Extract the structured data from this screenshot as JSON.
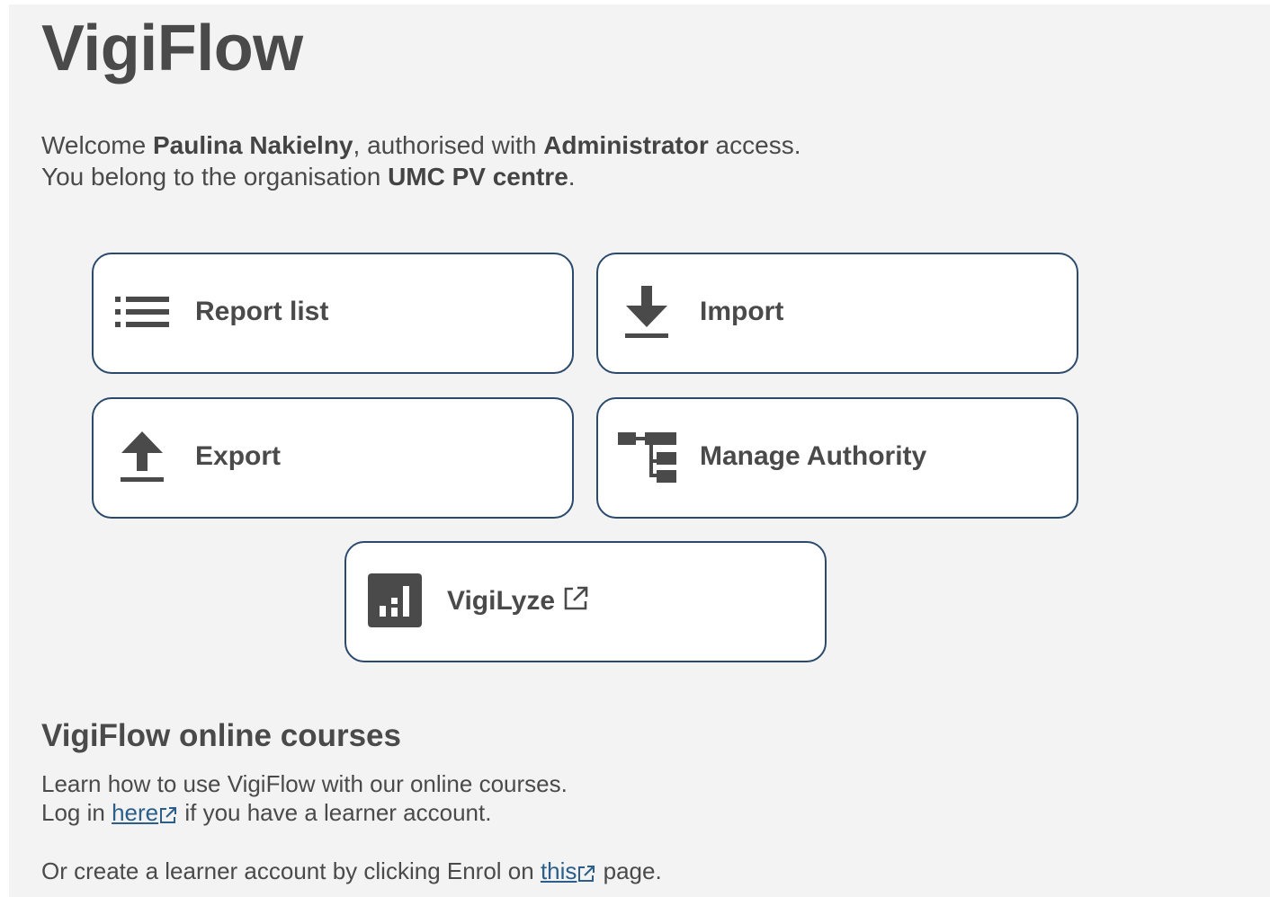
{
  "app": {
    "title": "VigiFlow"
  },
  "welcome": {
    "prefix": "Welcome ",
    "user_name": "Paulina Nakielny",
    "middle": ", authorised with ",
    "role": "Administrator",
    "suffix": " access.",
    "org_prefix": "You belong to the organisation ",
    "org_name": "UMC PV centre",
    "org_suffix": "."
  },
  "tiles": {
    "report_list": {
      "label": "Report list",
      "icon": "list-icon"
    },
    "import": {
      "label": "Import",
      "icon": "download-icon"
    },
    "export": {
      "label": "Export",
      "icon": "upload-icon"
    },
    "manage_authority": {
      "label": "Manage Authority",
      "icon": "hierarchy-icon"
    },
    "vigilyze": {
      "label": "VigiLyze",
      "icon": "bar-chart-icon",
      "external": true
    }
  },
  "courses": {
    "title": "VigiFlow online courses",
    "line1": "Learn how to use VigiFlow with our online courses.",
    "line2_prefix": "Log in ",
    "line2_link": "here",
    "line2_suffix": " if you have a learner account.",
    "line3_prefix": "Or create a learner account by clicking Enrol on ",
    "line3_link": "this",
    "line3_suffix": " page."
  },
  "colors": {
    "text": "#4a4a4a",
    "background": "#f3f3f3",
    "tile_border": "#2b4a6b",
    "link": "#2b5f8a",
    "icon": "#4a4a4a"
  }
}
